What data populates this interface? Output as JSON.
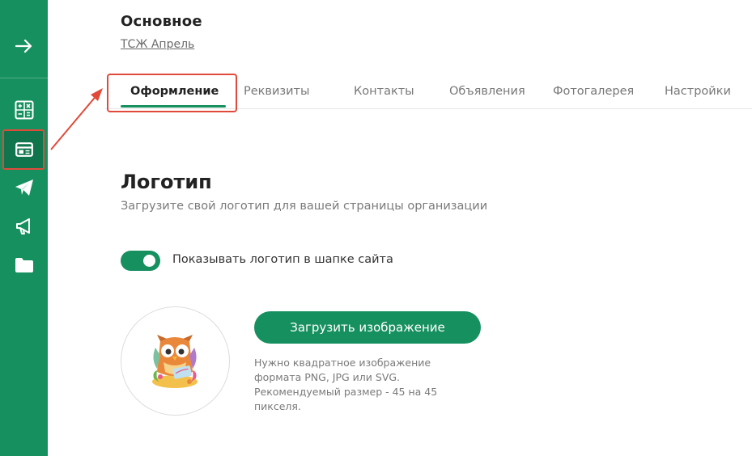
{
  "header": {
    "title": "Основное",
    "org_link": "ТСЖ Апрель"
  },
  "tabs": [
    {
      "label": "Оформление",
      "active": true
    },
    {
      "label": "Реквизиты",
      "active": false
    },
    {
      "label": "Контакты",
      "active": false
    },
    {
      "label": "Объявления",
      "active": false
    },
    {
      "label": "Фотогалерея",
      "active": false
    },
    {
      "label": "Настройки",
      "active": false
    }
  ],
  "sidebar": {
    "items": [
      {
        "icon": "arrow-right-icon"
      },
      {
        "icon": "calculator-icon"
      },
      {
        "icon": "page-layout-icon",
        "active": true
      },
      {
        "icon": "telegram-icon"
      },
      {
        "icon": "megaphone-icon"
      },
      {
        "icon": "folder-icon"
      }
    ]
  },
  "logo_section": {
    "title": "Логотип",
    "subtitle": "Загрузите свой логотип для вашей страницы организации",
    "toggle_label": "Показывать логотип в шапке сайта",
    "toggle_on": true,
    "upload_button": "Загрузить изображение",
    "hint_lines": [
      "Нужно квадратное изображение",
      "формата PNG, JPG или SVG.",
      "Рекомендуемый размер - 45 на 45",
      "пикселя."
    ]
  },
  "colors": {
    "brand_green": "#17905f",
    "sidebar_active": "#10744c",
    "annotation_red": "#e04a3a"
  }
}
